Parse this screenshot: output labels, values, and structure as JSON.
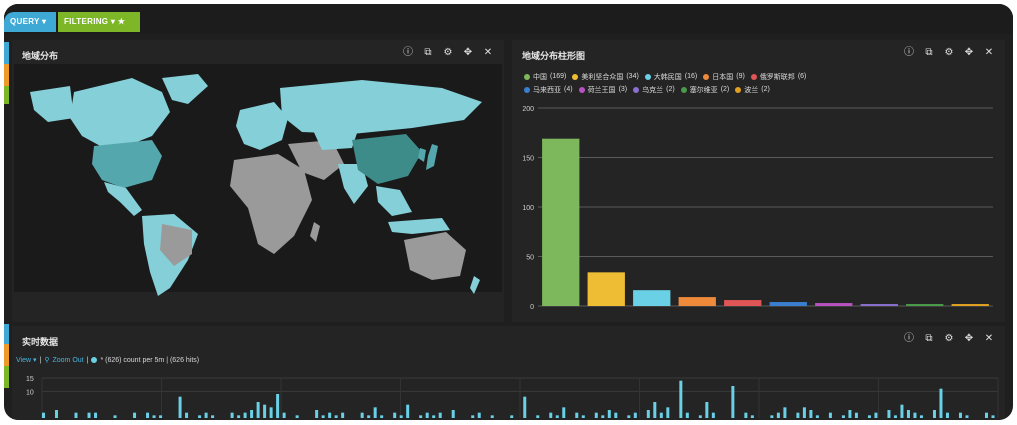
{
  "topbar": {
    "query_label": "QUERY",
    "filtering_label": "FILTERING"
  },
  "map_panel": {
    "title": "地域分布"
  },
  "bar_panel": {
    "title": "地域分布柱形图",
    "legend": [
      {
        "name": "中国",
        "count": "(169)",
        "color": "#7db85c"
      },
      {
        "name": "美利坚合众国",
        "count": "(34)",
        "color": "#efbd34"
      },
      {
        "name": "大韩民国",
        "count": "(16)",
        "color": "#6ad0e6"
      },
      {
        "name": "日本国",
        "count": "(9)",
        "color": "#ee8a3a"
      },
      {
        "name": "俄罗斯联邦",
        "count": "(6)",
        "color": "#e05555"
      },
      {
        "name": "马来西亚",
        "count": "(4)",
        "color": "#3a7fcf"
      },
      {
        "name": "荷兰王国",
        "count": "(3)",
        "color": "#b852c0"
      },
      {
        "name": "乌克兰",
        "count": "(2)",
        "color": "#8a6fcf"
      },
      {
        "name": "塞尔维亚",
        "count": "(2)",
        "color": "#4a9a4a"
      },
      {
        "name": "波兰",
        "count": "(2)",
        "color": "#e0a020"
      }
    ]
  },
  "realtime_panel": {
    "title": "实时数据",
    "view_label": "View ▾",
    "zoom_out_label": "Zoom Out",
    "series_summary": "* (626)  count per 5m | (626 hits)"
  },
  "chart_data": [
    {
      "type": "bar",
      "title": "地域分布柱形图",
      "categories": [
        "中国",
        "美利坚合众国",
        "大韩民国",
        "日本国",
        "俄罗斯联邦",
        "马来西亚",
        "荷兰王国",
        "乌克兰",
        "塞尔维亚",
        "波兰"
      ],
      "values": [
        169,
        34,
        16,
        9,
        6,
        4,
        3,
        2,
        2,
        2
      ],
      "colors": [
        "#7db85c",
        "#efbd34",
        "#6ad0e6",
        "#ee8a3a",
        "#e05555",
        "#3a7fcf",
        "#b852c0",
        "#8a6fcf",
        "#4a9a4a",
        "#e0a020"
      ],
      "ylim": [
        0,
        200
      ],
      "yticks": [
        0,
        50,
        100,
        150,
        200
      ],
      "grid": true
    },
    {
      "type": "bar",
      "title": "实时数据",
      "ylim": [
        0,
        15
      ],
      "yticks": [
        10,
        15
      ],
      "color": "#6ad0e6",
      "values": [
        2,
        0,
        3,
        0,
        0,
        2,
        0,
        2,
        2,
        0,
        0,
        1,
        0,
        0,
        2,
        0,
        2,
        1,
        1,
        0,
        0,
        8,
        2,
        0,
        1,
        2,
        1,
        0,
        0,
        2,
        1,
        2,
        3,
        6,
        5,
        4,
        9,
        2,
        0,
        1,
        0,
        0,
        3,
        1,
        2,
        1,
        2,
        0,
        0,
        2,
        1,
        4,
        1,
        0,
        2,
        1,
        5,
        0,
        1,
        2,
        1,
        2,
        0,
        3,
        0,
        0,
        1,
        2,
        0,
        1,
        0,
        0,
        1,
        0,
        8,
        0,
        1,
        0,
        2,
        1,
        4,
        0,
        2,
        1,
        0,
        2,
        1,
        3,
        2,
        0,
        1,
        2,
        0,
        3,
        6,
        2,
        4,
        0,
        14,
        2,
        0,
        1,
        6,
        2,
        0,
        0,
        12,
        0,
        2,
        1,
        0,
        0,
        1,
        2,
        4,
        0,
        2,
        4,
        3,
        1,
        0,
        2,
        0,
        1,
        3,
        2,
        0,
        1,
        2,
        0,
        3,
        1,
        5,
        3,
        2,
        1,
        0,
        3,
        11,
        2,
        0,
        2,
        1,
        0,
        0,
        2,
        1
      ]
    }
  ]
}
